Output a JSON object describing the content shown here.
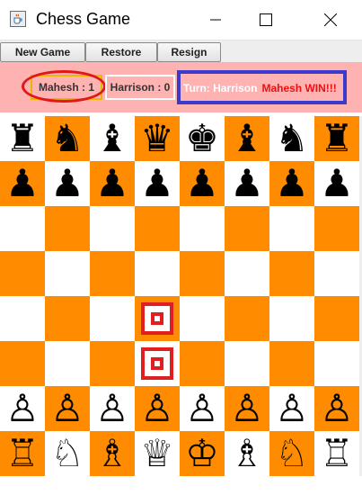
{
  "window": {
    "title": "Chess Game",
    "app_icon": "coffee-cup-icon",
    "controls": [
      "minimize-icon",
      "maximize-icon",
      "close-icon"
    ]
  },
  "toolbar": {
    "new_game_label": "New Game",
    "restore_label": "Restore",
    "resign_label": "Resign"
  },
  "status": {
    "player1_score": "Mahesh : 1",
    "player2_score": "Harrison : 0",
    "turn_text": "Turn: Harrison",
    "winner_text": "Mahesh WIN!!!"
  },
  "colors": {
    "light_square": "#ffffff",
    "dark_square": "#ff8c00",
    "status_background": "#ffb2b2",
    "highlight_ellipse": "#e11616",
    "highlight_box": "#3a3acc",
    "winner_text": "#ee1010",
    "target_marker": "#e02020"
  },
  "board": {
    "ranks": [
      [
        "♜",
        "♞",
        "♝",
        "♛",
        "♚",
        "♝",
        "♞",
        "♜"
      ],
      [
        "♟",
        "♟",
        "♟",
        "♟",
        "♟",
        "♟",
        "♟",
        "♟"
      ],
      [
        "",
        "",
        "",
        "",
        "",
        "",
        "",
        ""
      ],
      [
        "",
        "",
        "",
        "",
        "",
        "",
        "",
        ""
      ],
      [
        "",
        "",
        "",
        "target",
        "",
        "",
        "",
        ""
      ],
      [
        "",
        "",
        "",
        "target",
        "",
        "",
        "",
        ""
      ],
      [
        "♙",
        "♙",
        "♙",
        "♙",
        "♙",
        "♙",
        "♙",
        "♙"
      ],
      [
        "♖",
        "♘",
        "♗",
        "♕",
        "♔",
        "♗",
        "♘",
        "♖"
      ]
    ]
  }
}
